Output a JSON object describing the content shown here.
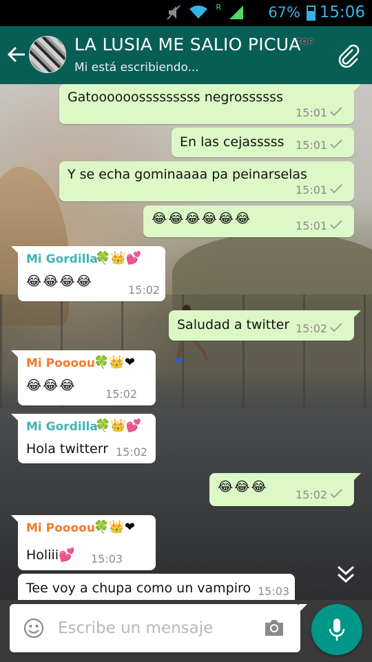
{
  "status_bar": {
    "battery": "67%",
    "time": "15:06",
    "network_label": "R"
  },
  "header": {
    "title": "LA LUSIA ME SALIO PICUA",
    "subtitle": "Mi está escribiendo...",
    "top_badge": "TOP"
  },
  "messages": [
    {
      "dir": "out",
      "text": "Gatoooooosssssssss negrossssss",
      "time": "15:01"
    },
    {
      "dir": "out",
      "text": "En las cejasssss",
      "time": "15:01"
    },
    {
      "dir": "out",
      "text": "Y se echa gominaaaa pa peinarselas",
      "time": "15:01"
    },
    {
      "dir": "out",
      "text": "😂😂😂😂😂😂",
      "time": "15:01"
    },
    {
      "dir": "in",
      "sender": "Mi Gordilla",
      "sender_deco": "🍀👑💕",
      "text": "😂😂😂😂",
      "time": "15:02"
    },
    {
      "dir": "out",
      "text": "Saludad a twitter",
      "time": "15:02"
    },
    {
      "dir": "in",
      "sender": "Mi Poooou",
      "sender_deco": "🍀👑❤",
      "text": "😂😂😂",
      "time": "15:02"
    },
    {
      "dir": "in",
      "sender": "Mi Gordilla",
      "sender_deco": "🍀👑💕",
      "text": "Hola twitterr",
      "time": "15:02"
    },
    {
      "dir": "out",
      "text": "😂😂😂",
      "time": "15:02"
    },
    {
      "dir": "in",
      "sender": "Mi Poooou",
      "sender_deco": "🍀👑❤",
      "text": "Holiii💕",
      "time": "15:03"
    },
    {
      "dir": "in",
      "text": "Tee voy a chupa como un vampiro",
      "time": "15:03"
    }
  ],
  "composer": {
    "placeholder": "Escribe un mensaje"
  },
  "colors": {
    "header": "#075e54",
    "outgoing_bubble": "#dcf8c6",
    "incoming_bubble": "#ffffff",
    "sender_gordilla": "#3fb4b4",
    "sender_poooou": "#f07a2a",
    "mic_button": "#009688",
    "status_accent": "#33b5e5"
  },
  "icons": [
    "mute-icon",
    "wifi-icon",
    "signal-icon",
    "battery-icon",
    "back-arrow-icon",
    "attach-icon",
    "scroll-down-icon",
    "emoji-icon",
    "camera-icon",
    "mic-icon",
    "double-check-icon"
  ]
}
